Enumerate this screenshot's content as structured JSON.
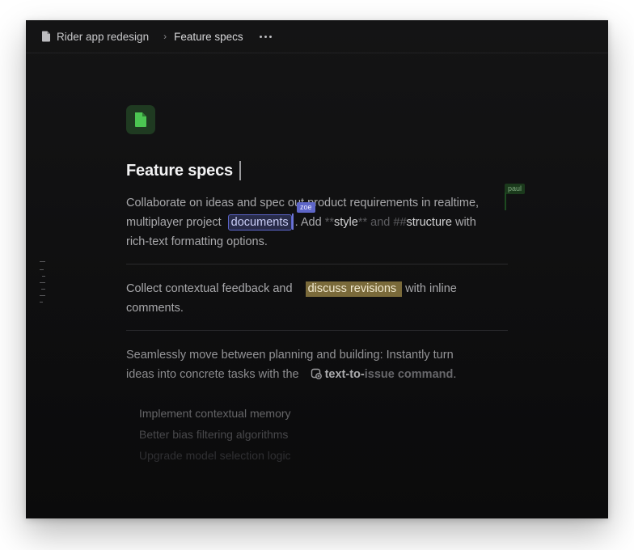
{
  "breadcrumb": {
    "project": "Rider app redesign",
    "separator": "›",
    "page": "Feature specs"
  },
  "document": {
    "title": "Feature specs",
    "paragraph1": {
      "text_a": "Collaborate on ideas and spec out product requirements in realtime,",
      "text_b": "multiplayer project",
      "selected_word": "documents",
      "text_c": ". Add ",
      "md_a": "**",
      "bold_word": "style",
      "md_b": "** and ",
      "md_c": "##",
      "structure_word": "structure",
      "text_d": " with",
      "text_e": "rich-text formatting options."
    },
    "paragraph2": {
      "text_a": "Collect contextual feedback and",
      "highlight": "discuss revisions",
      "text_b": " with inline",
      "text_c": "comments."
    },
    "paragraph3": {
      "text_a": "Seamlessly move between planning and building: Instantly turn",
      "text_b": "ideas into concrete tasks with the",
      "command_a": "text-to-",
      "command_b": "issue",
      "command_c": " command",
      "text_c": "."
    },
    "tasks": [
      "Implement contextual memory",
      "Better bias filtering algorithms",
      "Upgrade model selection logic"
    ]
  },
  "collaborators": {
    "zoe": {
      "name": "zoe",
      "color": "#5e66c8"
    },
    "paul": {
      "name": "paul",
      "color": "#1b3a1c"
    }
  },
  "icons": {
    "document_page": "file-icon",
    "document_large": "document-icon",
    "command": "issue-command-icon"
  },
  "colors": {
    "accent_green": "#4cc552",
    "selection_blue": "#5b64c9",
    "highlight_gold": "#7a6a3a"
  }
}
